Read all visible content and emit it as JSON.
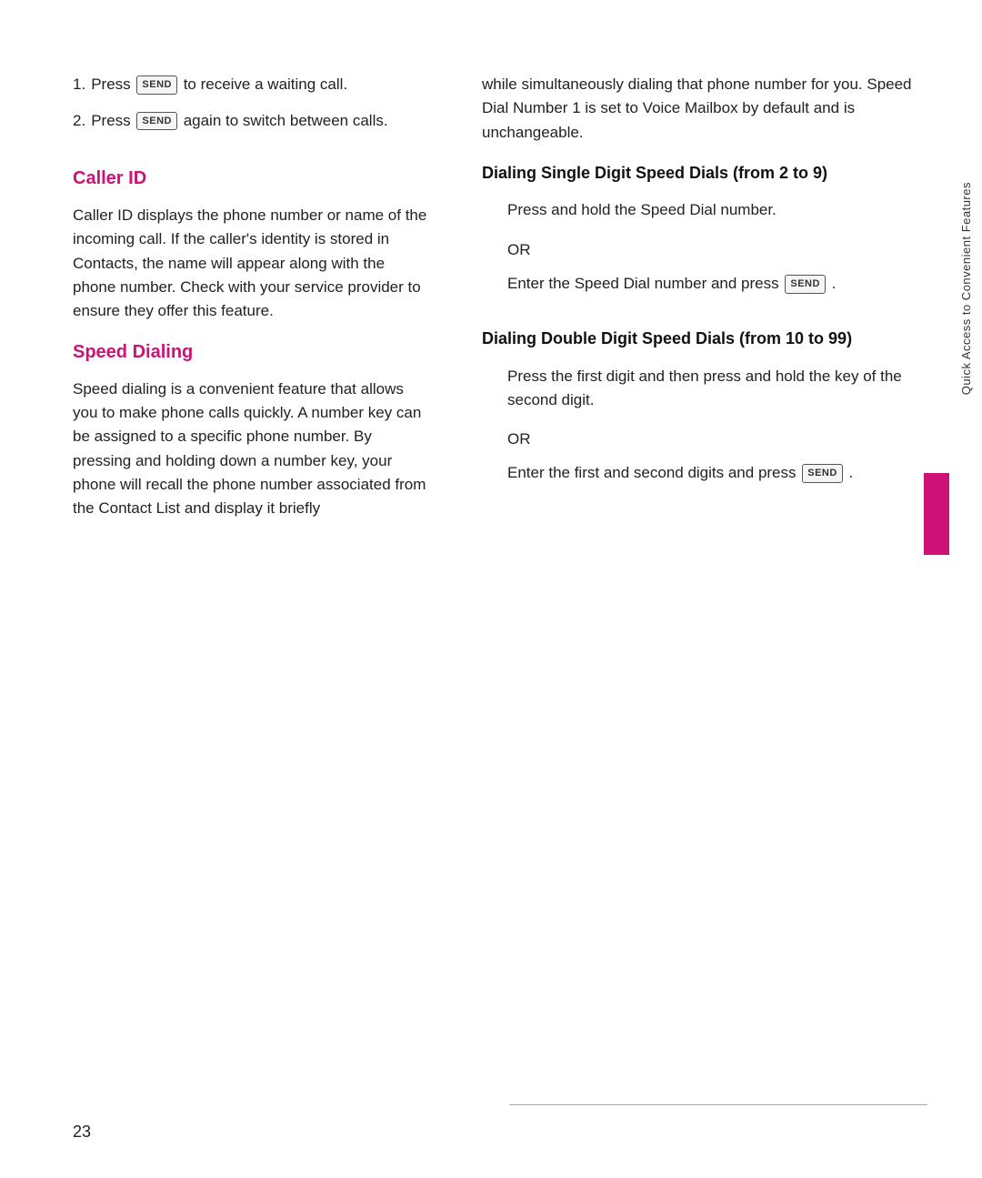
{
  "page": {
    "number": "23",
    "sidebar_label": "Quick Access to Convenient Features"
  },
  "left_column": {
    "intro_items": [
      {
        "number": "1.",
        "text_before": "Press",
        "badge": "SEND",
        "text_after": "to receive a waiting call."
      },
      {
        "number": "2.",
        "text_before": "Press",
        "badge": "SEND",
        "text_after": "again to switch between calls."
      }
    ],
    "caller_id_heading": "Caller ID",
    "caller_id_body": "Caller ID displays the phone number or name of the incoming call. If the caller's identity is stored in Contacts, the name will appear along with the phone number. Check with your service provider to ensure they offer this feature.",
    "speed_dialing_heading": "Speed Dialing",
    "speed_dialing_body": "Speed dialing is a convenient feature that allows you to make phone calls quickly. A number key can be assigned to a specific phone number. By pressing and holding down a number key, your phone will recall the phone number associated from the Contact List and display it briefly"
  },
  "right_column": {
    "intro_text": "while simultaneously dialing that phone number for you. Speed Dial Number 1 is set to Voice Mailbox by default and is unchangeable.",
    "single_digit": {
      "heading": "Dialing Single Digit Speed Dials (from 2 to 9)",
      "step1": "Press and hold the Speed Dial number.",
      "or_label": "OR",
      "step2_before": "Enter the Speed Dial number and press",
      "step2_badge": "SEND",
      "step2_after": "."
    },
    "double_digit": {
      "heading": "Dialing Double Digit Speed Dials (from 10 to 99)",
      "step1": "Press the first digit and then press and hold the key of the second digit.",
      "or_label": "OR",
      "step2_before": "Enter the first and second digits and press",
      "step2_badge": "SEND",
      "step2_after": "."
    }
  }
}
